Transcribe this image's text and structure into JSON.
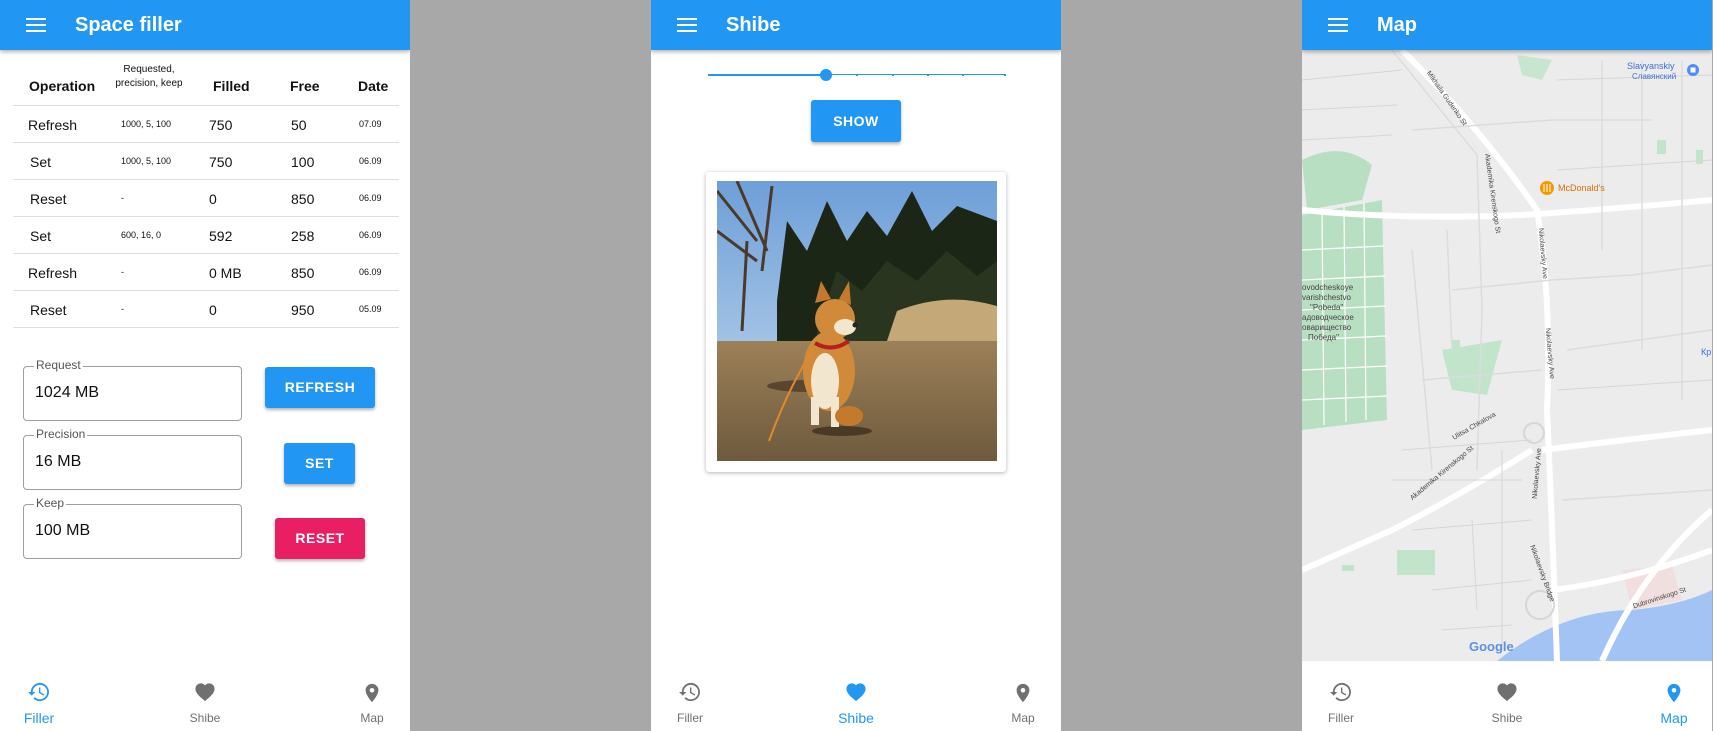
{
  "filler": {
    "title": "Space filler",
    "table": {
      "headers": {
        "operation": "Operation",
        "requested": "Requested, precision, keep",
        "filled": "Filled",
        "free": "Free",
        "date": "Date"
      },
      "rows": [
        {
          "operation": "Refresh",
          "requested": "1000, 5, 100",
          "filled": "750",
          "free": "50",
          "date": "07.09"
        },
        {
          "operation": "Set",
          "requested": "1000, 5, 100",
          "filled": "750",
          "free": "100",
          "date": "06.09"
        },
        {
          "operation": "Reset",
          "requested": "-",
          "filled": "0",
          "free": "850",
          "date": "06.09"
        },
        {
          "operation": "Set",
          "requested": "600, 16, 0",
          "filled": "592",
          "free": "258",
          "date": "06.09"
        },
        {
          "operation": "Refresh",
          "requested": "-",
          "filled": "0 MB",
          "free": "850",
          "date": "06.09"
        },
        {
          "operation": "Reset",
          "requested": "-",
          "filled": "0",
          "free": "950",
          "date": "05.09"
        }
      ]
    },
    "fields": {
      "request": {
        "label": "Request",
        "value": "1024 MB"
      },
      "precision": {
        "label": "Precision",
        "value": "16 MB"
      },
      "keep": {
        "label": "Keep",
        "value": "100 MB"
      }
    },
    "buttons": {
      "refresh": "REFRESH",
      "set": "SET",
      "reset": "RESET"
    }
  },
  "shibe": {
    "title": "Shibe",
    "slider": {
      "value_step": 3,
      "steps": 10
    },
    "show_label": "SHOW"
  },
  "map": {
    "title": "Map",
    "labels": {
      "slavyanskiy": "Slavyanskiy",
      "slavyanskiy_ru": "Славянский",
      "mcdonalds": "McDonald's",
      "mikhaila": "Mikhaila Gudenko St",
      "akademika": "Akademika Kirenskogo St",
      "nikolaevsky": "Nikolaevsky Ave",
      "ulitsa": "Ulitsa Chkalova",
      "dubrovinskogo": "Dubrovinskogo St",
      "bridge": "Nikolaevsky Bridge",
      "garden1": "ovodcheskoye",
      "garden2": "varishchestvo",
      "garden3": "\"Pobeda\"",
      "garden4": "адоводческое",
      "garden5": "оварищество",
      "garden6": "Победа\"",
      "edge": "Кр",
      "google": "Google"
    }
  },
  "nav": {
    "filler": "Filler",
    "shibe": "Shibe",
    "map": "Map"
  },
  "colors": {
    "primary": "#2196f3",
    "accent": "#e91e63",
    "divider_bg": "#a8a8a8"
  }
}
